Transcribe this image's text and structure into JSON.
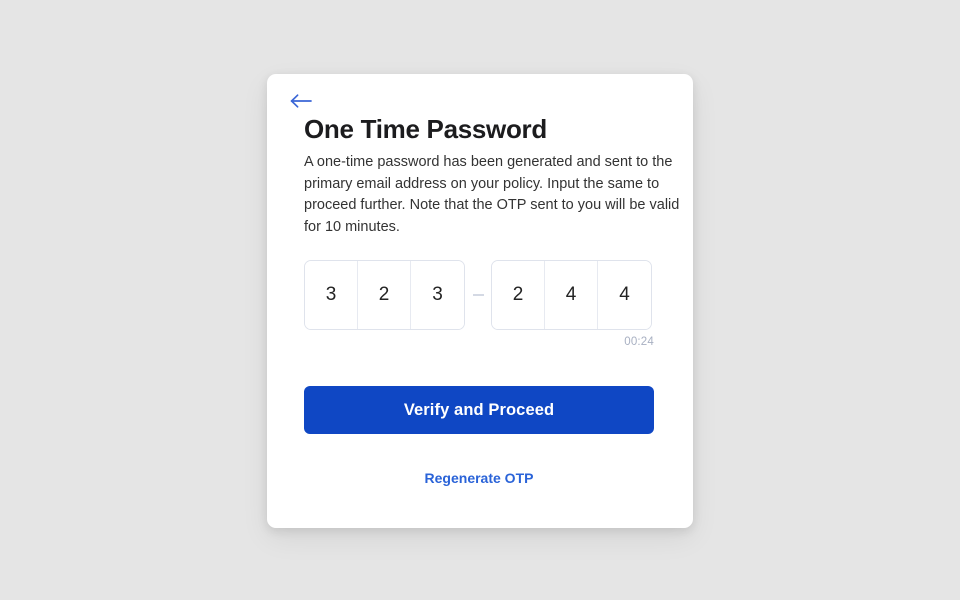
{
  "page": {
    "background_color": "#e5e5e5"
  },
  "card": {
    "background_color": "#ffffff",
    "back_button": {
      "icon": "arrow-left-icon",
      "color": "#3a66d6",
      "label": ""
    },
    "title": "One Time Password",
    "description": "A one-time password has been generated and sent to the primary email address on your policy. Input the same to proceed further. Note that the OTP sent to you will be valid for 10 minutes.",
    "otp": {
      "group_one": [
        "3",
        "2",
        "3"
      ],
      "separator": "–",
      "group_two": [
        "2",
        "4",
        "4"
      ],
      "timer": "00:24",
      "border_color": "#dfe3ec",
      "digit_color": "#232323"
    },
    "primary_button": {
      "label": "Verify and Proceed",
      "background_color": "#0f47c4",
      "text_color": "#ffffff"
    },
    "secondary_link": {
      "label": "Regenerate OTP",
      "color": "#2a63d8"
    }
  }
}
